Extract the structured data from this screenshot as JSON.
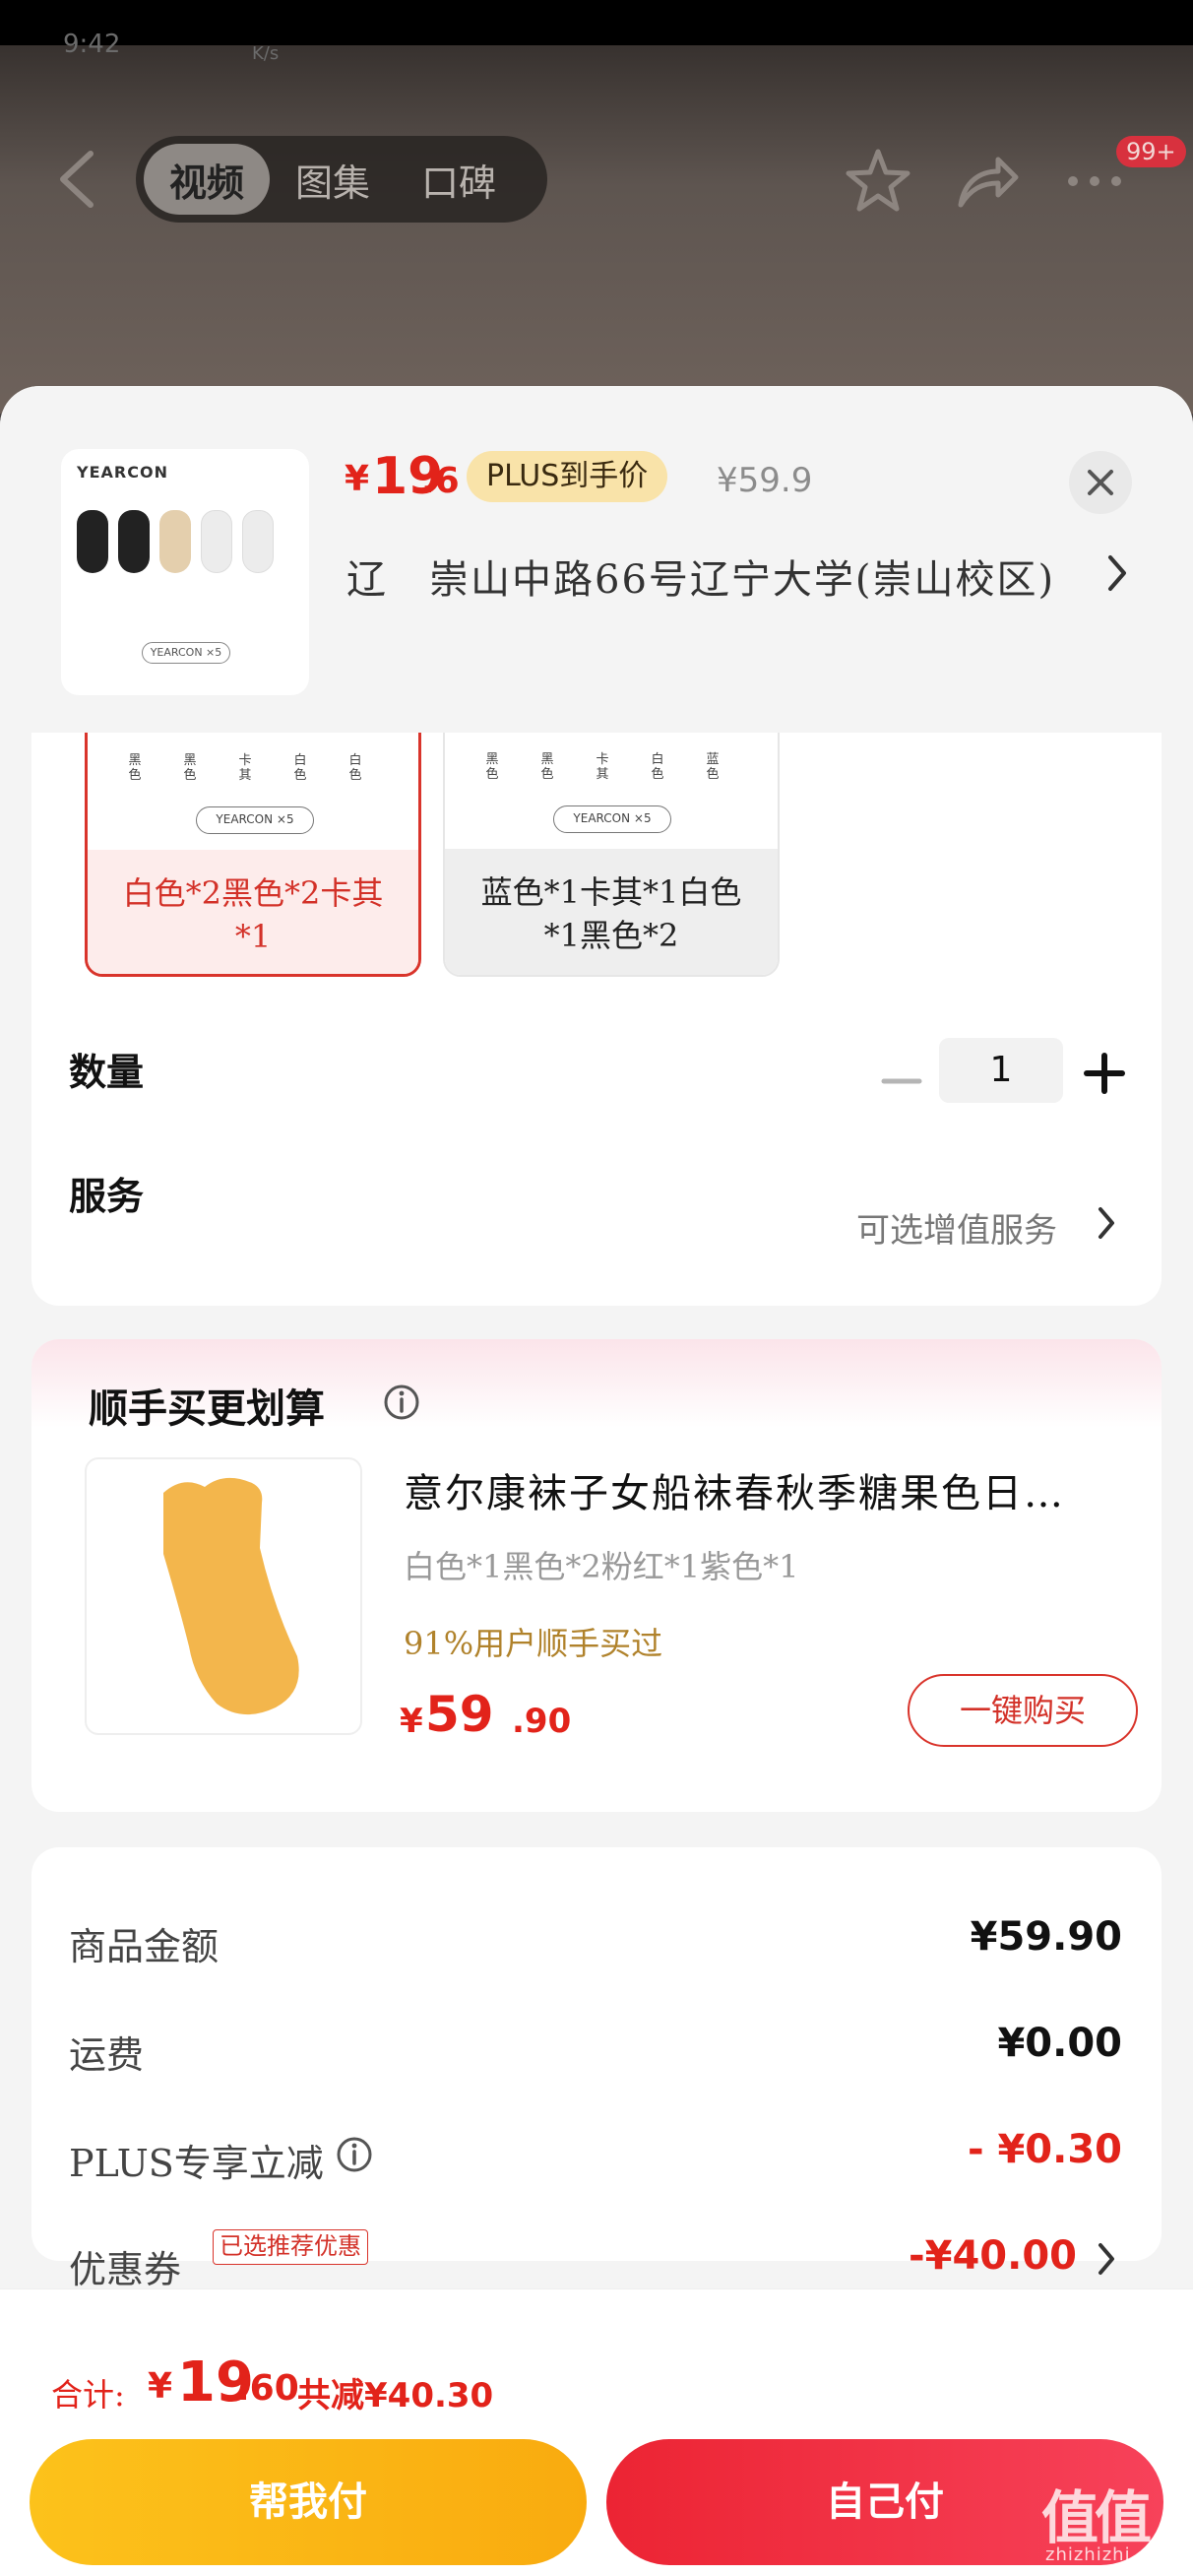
{
  "status_bar": {
    "time": "9:42",
    "speed_unit": "K/s"
  },
  "media_tabs": [
    "视频",
    "图集",
    "口碑"
  ],
  "notification_badge": "99+",
  "product": {
    "brand": "YEARCON",
    "price_currency": "¥",
    "price_integer": "19",
    "price_decimal": ".6",
    "plus_badge": "PLUS到手价",
    "original_price": "¥59.9",
    "address": "辽　崇山中路66号辽宁大学(崇山校区)",
    "pack_label": "YEARCON ×5"
  },
  "variants": [
    {
      "label": "白色*2黑色*2卡其*1",
      "selected": true,
      "sock_colors": [
        "#1f1f1f",
        "#1f1f1f",
        "#e8d4b4",
        "#eeeeee",
        "#eeeeee"
      ],
      "color_labels": [
        "黑色",
        "黑色",
        "卡其",
        "白色",
        "白色"
      ]
    },
    {
      "label": "蓝色*1卡其*1白色*1黑色*2",
      "selected": false,
      "sock_colors": [
        "#1f1f1f",
        "#1f1f1f",
        "#e8d4b4",
        "#eeeeee",
        "#9fb9dc"
      ],
      "color_labels": [
        "黑色",
        "黑色",
        "卡其",
        "白色",
        "蓝色"
      ]
    }
  ],
  "quantity": {
    "label": "数量",
    "value": "1"
  },
  "service": {
    "label": "服务",
    "hint": "可选增值服务"
  },
  "addon": {
    "title": "顺手买更划算",
    "name": "意尔康袜子女船袜春秋季糖果色日…",
    "spec": "白色*1黑色*2粉红*1紫色*1",
    "buyers": "91%用户顺手买过",
    "price_currency": "¥",
    "price_integer": "59",
    "price_decimal": ".90",
    "buy_label": "一键购买"
  },
  "summary": {
    "rows": [
      {
        "label": "商品金额",
        "value": "¥59.90",
        "red": false
      },
      {
        "label": "运费",
        "value": "¥0.00",
        "red": false
      },
      {
        "label": "PLUS专享立减",
        "value": "- ¥0.30",
        "red": true
      },
      {
        "label": "优惠券",
        "value": "-¥40.00",
        "red": true
      }
    ],
    "coupon_tag": "已选推荐优惠"
  },
  "total": {
    "label": "合计:",
    "currency": "¥",
    "integer": "19",
    "decimal": ".60",
    "saved": "共减¥40.30"
  },
  "buttons": {
    "pay_friend": "帮我付",
    "pay_self": "自己付"
  },
  "watermark": {
    "logo": "值值值",
    "url": "zhizhizhi.com"
  },
  "colors": {
    "accent_red": "#e2231a",
    "plus_gold": "#f9e3a9",
    "pay_friend": "#fcc21b",
    "pay_self": "#ec2433"
  }
}
